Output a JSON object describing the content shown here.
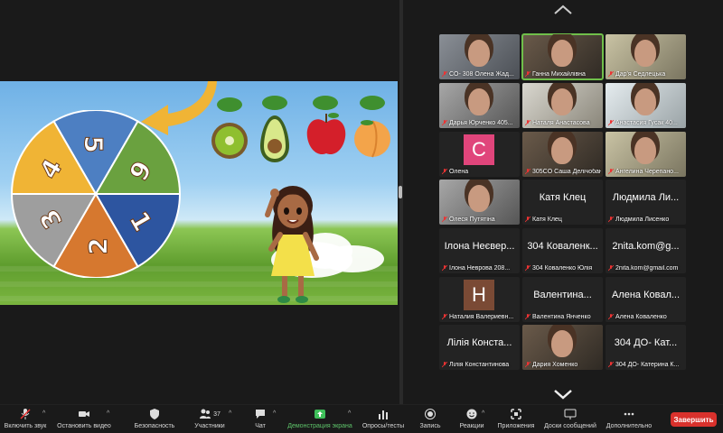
{
  "share": {
    "wheel_numbers": [
      "5",
      "6",
      "1",
      "2",
      "3",
      "4"
    ],
    "colors": {
      "blue": "#4d7fc2",
      "green": "#6aa13f",
      "navy": "#2d55a0",
      "orange": "#d6782f",
      "gray": "#9e9e9e",
      "yellow": "#f0b435"
    },
    "fruits": [
      "kiwi",
      "avocado",
      "apple",
      "peach"
    ]
  },
  "gallery": {
    "tiles": [
      {
        "name": "CO- 308 Олена Жад...",
        "type": "video",
        "active": false
      },
      {
        "name": "Ганна Михайлівна",
        "type": "video",
        "active": true
      },
      {
        "name": "Дар'я Седлецька",
        "type": "video",
        "active": false
      },
      {
        "name": "Дарья Юрченко 405...",
        "type": "video",
        "active": false
      },
      {
        "name": "Наталя Анастасова",
        "type": "video",
        "active": false
      },
      {
        "name": "Анастасия Гусак 40...",
        "type": "video",
        "active": false
      },
      {
        "name": "Олена",
        "type": "avatar",
        "letter": "C",
        "avatar_color": "#e0457b"
      },
      {
        "name": "305CO Саша Делічобан",
        "type": "video",
        "active": false
      },
      {
        "name": "Ангелина Черепано...",
        "type": "video",
        "active": false
      },
      {
        "name": "Олеся Путятіна",
        "type": "video",
        "active": false
      },
      {
        "name": "Катя Клец",
        "type": "name",
        "big": "Катя Клец"
      },
      {
        "name": "Людмила Лисенко",
        "type": "name",
        "big": "Людмила Ли..."
      },
      {
        "name": "Ілона Неврова 208...",
        "type": "name",
        "big": "Ілона Неєвер..."
      },
      {
        "name": "304 Коваленко Юлія",
        "type": "name",
        "big": "304 Коваленк..."
      },
      {
        "name": "2nita.kom@gmail.com",
        "type": "name",
        "big": "2nita.kom@g..."
      },
      {
        "name": "Наталия Валериевн...",
        "type": "avatar",
        "letter": "Н",
        "avatar_color": "#7a4a35"
      },
      {
        "name": "Валентина Янченко",
        "type": "name",
        "big": "Валентина..."
      },
      {
        "name": "Алена Коваленко",
        "type": "name",
        "big": "Алена Ковал..."
      },
      {
        "name": "Лілія Константинова",
        "type": "name",
        "big": "Лілія Конста..."
      },
      {
        "name": "Дария Хоменко",
        "type": "video",
        "active": false
      },
      {
        "name": "304 ДО- Катерина К...",
        "type": "name",
        "big": "304 ДО- Кат..."
      }
    ]
  },
  "toolbar": {
    "unmute": "Включить звук",
    "stop_video": "Остановить видео",
    "security": "Безопасность",
    "participants": "Участники",
    "participants_count": "37",
    "chat": "Чат",
    "share_screen": "Демонстрация экрана",
    "polls": "Опросы/тесты",
    "record": "Запись",
    "reactions": "Реакции",
    "apps": "Приложения",
    "whiteboards": "Доски сообщений",
    "more": "Дополнительно",
    "end": "Завершить"
  }
}
